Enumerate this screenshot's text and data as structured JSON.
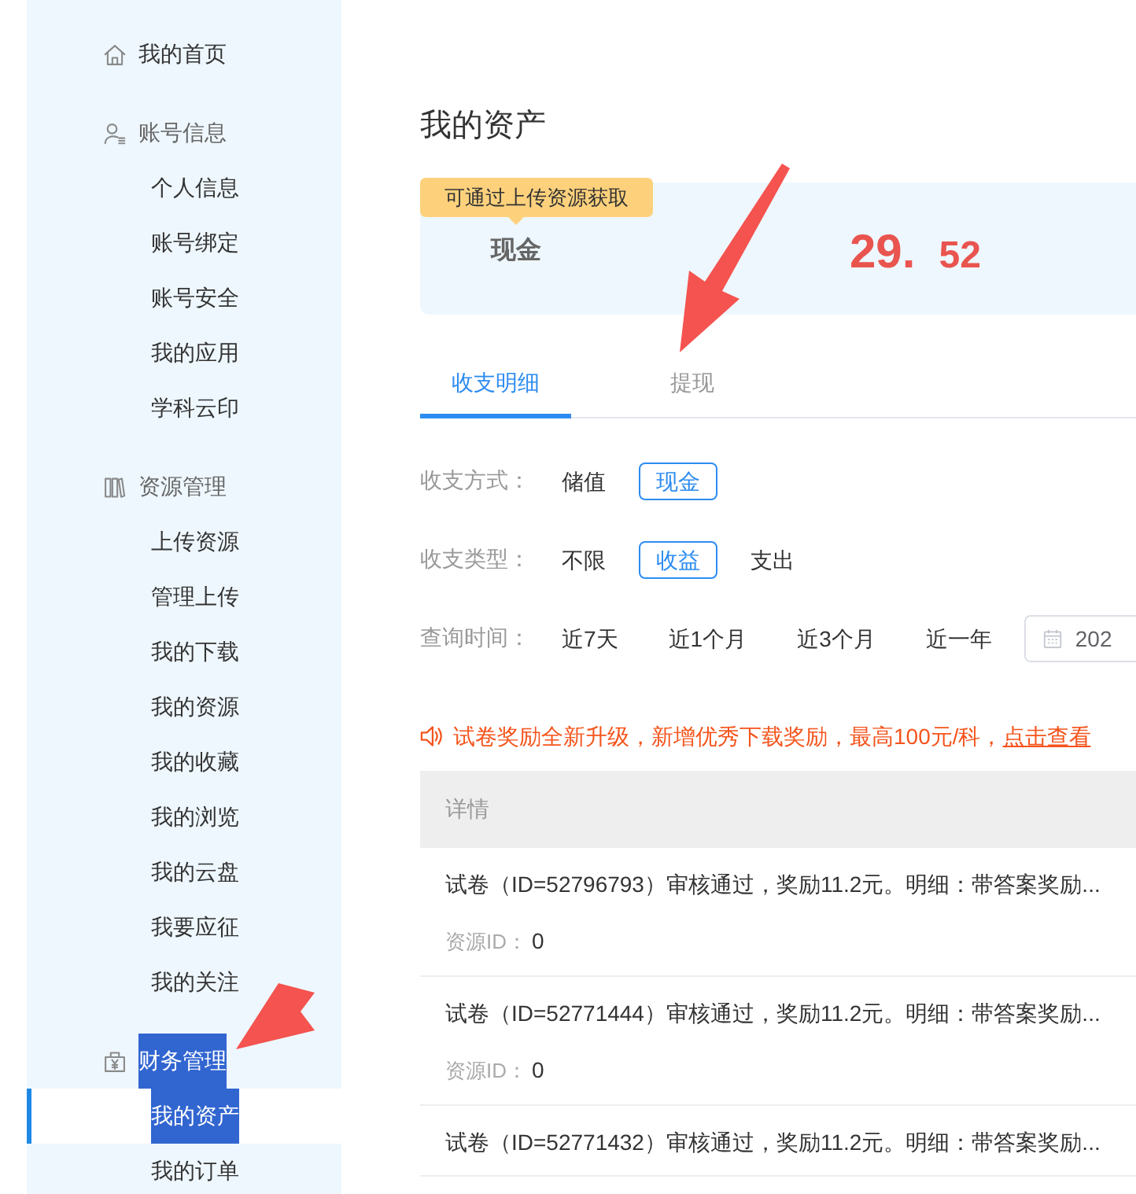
{
  "sidebar": {
    "groups": [
      {
        "kind": "link",
        "label": "我的首页",
        "pointed_at": false,
        "text_selected": false
      },
      {
        "kind": "heading",
        "label": "账号信息",
        "pointed_at": false,
        "text_selected": false,
        "items": [
          {
            "label": "个人信息",
            "selected": false,
            "text_selected": false
          },
          {
            "label": "账号绑定",
            "selected": false,
            "text_selected": false
          },
          {
            "label": "账号安全",
            "selected": false,
            "text_selected": false
          },
          {
            "label": "我的应用",
            "selected": false,
            "text_selected": false
          },
          {
            "label": "学科云印",
            "selected": false,
            "text_selected": false
          }
        ]
      },
      {
        "kind": "heading",
        "label": "资源管理",
        "pointed_at": false,
        "text_selected": false,
        "items": [
          {
            "label": "上传资源",
            "selected": false,
            "text_selected": false
          },
          {
            "label": "管理上传",
            "selected": false,
            "text_selected": false
          },
          {
            "label": "我的下载",
            "selected": false,
            "text_selected": false
          },
          {
            "label": "我的资源",
            "selected": false,
            "text_selected": false
          },
          {
            "label": "我的收藏",
            "selected": false,
            "text_selected": false
          },
          {
            "label": "我的浏览",
            "selected": false,
            "text_selected": false
          },
          {
            "label": "我的云盘",
            "selected": false,
            "text_selected": false
          },
          {
            "label": "我要应征",
            "selected": false,
            "text_selected": false
          },
          {
            "label": "我的关注",
            "selected": false,
            "text_selected": false
          }
        ]
      },
      {
        "kind": "heading",
        "label": "财务管理",
        "pointed_at": true,
        "text_selected": true,
        "items": [
          {
            "label": "我的资产",
            "selected": true,
            "text_selected": true
          },
          {
            "label": "我的订单",
            "selected": false,
            "text_selected": false
          }
        ]
      }
    ]
  },
  "page_title": "我的资产",
  "balance_card": {
    "tooltip": "可通过上传资源获取",
    "label": "现金",
    "amount_whole": "29.",
    "amount_fraction": "52"
  },
  "tabs": [
    {
      "label": "收支明细",
      "selected": true,
      "pointed_at": false
    },
    {
      "label": "提现",
      "selected": false,
      "pointed_at": true
    }
  ],
  "filters": [
    {
      "label": "收支方式：",
      "options": [
        {
          "label": "储值",
          "selected": false
        },
        {
          "label": "现金",
          "selected": true
        }
      ]
    },
    {
      "label": "收支类型：",
      "options": [
        {
          "label": "不限",
          "selected": false
        },
        {
          "label": "收益",
          "selected": true
        },
        {
          "label": "支出",
          "selected": false
        }
      ]
    },
    {
      "label": "查询时间：",
      "options": [
        {
          "label": "近7天",
          "selected": false
        },
        {
          "label": "近1个月",
          "selected": false
        },
        {
          "label": "近3个月",
          "selected": false
        },
        {
          "label": "近一年",
          "selected": false
        }
      ],
      "date_field": {
        "value": "202"
      }
    }
  ],
  "notice": {
    "text": "试卷奖励全新升级，新增优秀下载奖励，最高100元/科，",
    "link": "点击查看"
  },
  "table": {
    "columns": [
      "详情"
    ],
    "rows": [
      {
        "detail": "试卷（ID=52796793）审核通过，奖励11.2元。明细：带答案奖励...",
        "resource_label": "资源ID：",
        "resource_id": "0"
      },
      {
        "detail": "试卷（ID=52771444）审核通过，奖励11.2元。明细：带答案奖励...",
        "resource_label": "资源ID：",
        "resource_id": "0"
      },
      {
        "detail": "试卷（ID=52771432）审核通过，奖励11.2元。明细：带答案奖励..."
      }
    ]
  }
}
